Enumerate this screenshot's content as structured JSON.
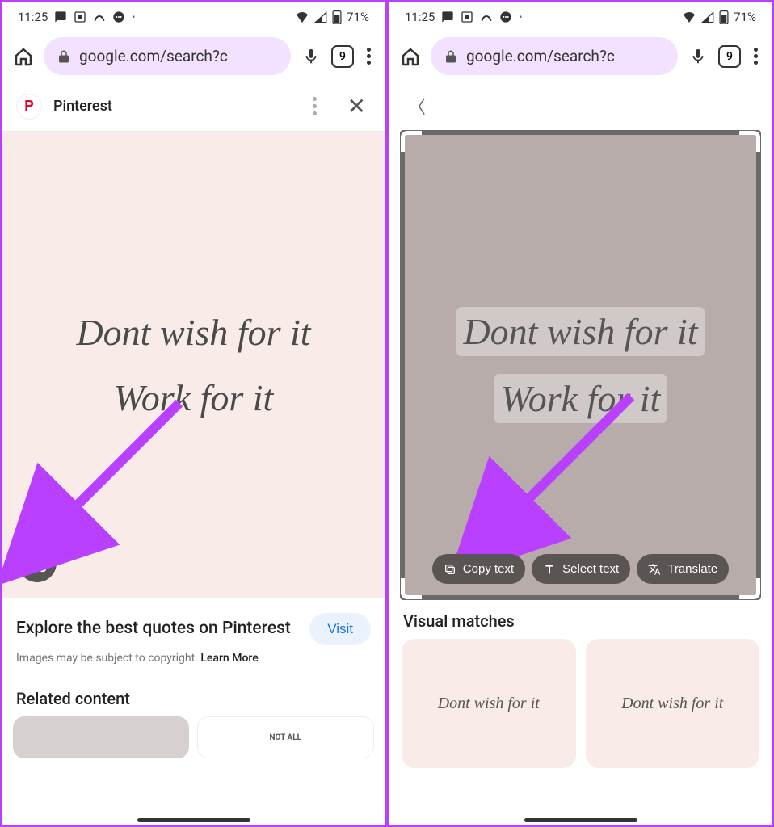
{
  "status": {
    "time": "11:25",
    "battery": "71%"
  },
  "omnibar": {
    "url": "google.com/search?c",
    "tabs": "9"
  },
  "left": {
    "source": "Pinterest",
    "quote1": "Dont wish for it",
    "quote2": "Work for it",
    "title": "Explore the best quotes on Pinterest",
    "visit": "Visit",
    "copyright_prefix": "Images may be subject to copyright. ",
    "learn_more": "Learn More",
    "related": "Related content",
    "thumb2": "NOT ALL"
  },
  "right": {
    "quote1": "Dont wish for it",
    "quote2": "Work for it",
    "copy": "Copy text",
    "select": "Select text",
    "translate": "Translate",
    "visual_matches": "Visual matches",
    "thumb_text": "Dont wish for it"
  }
}
